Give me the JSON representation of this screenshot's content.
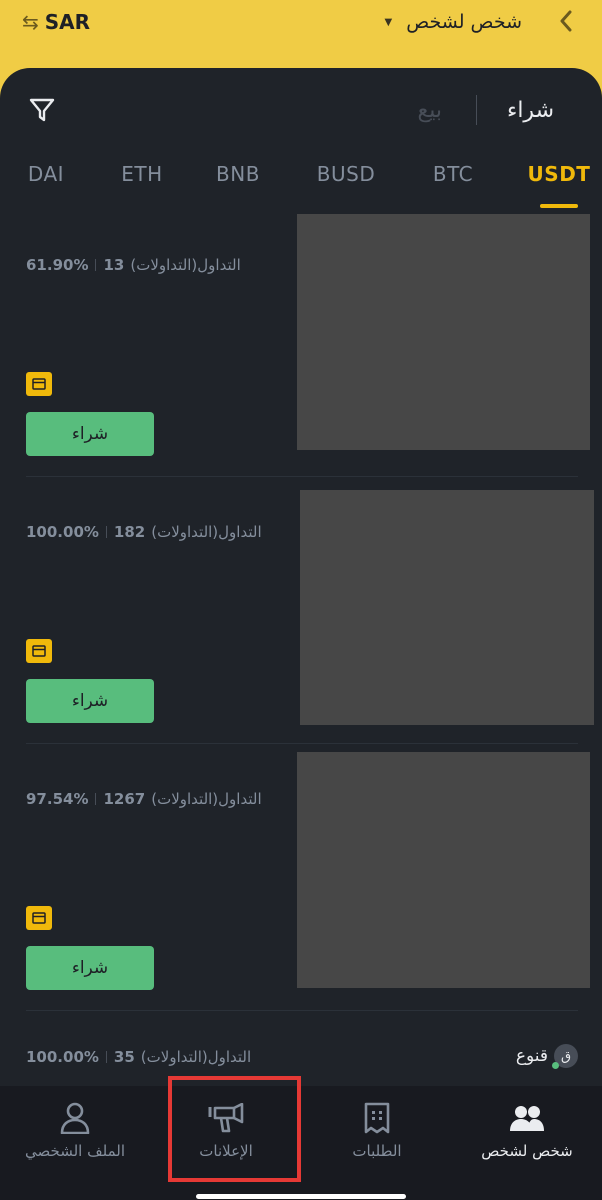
{
  "header": {
    "currency": "SAR",
    "mode": "شخص لشخص"
  },
  "side_tabs": {
    "buy": "شراء",
    "sell": "بيع"
  },
  "asset_tabs": [
    "DAI",
    "ETH",
    "BNB",
    "BUSD",
    "BTC",
    "USDT"
  ],
  "active_asset": "USDT",
  "offers": [
    {
      "completion": "61.90%",
      "count": "13",
      "trades_label": "التداول(التداولات)",
      "button": "شراء"
    },
    {
      "completion": "100.00%",
      "count": "182",
      "trades_label": "التداول(التداولات)",
      "button": "شراء"
    },
    {
      "completion": "97.54%",
      "count": "1267",
      "trades_label": "التداول(التداولات)",
      "button": "شراء"
    },
    {
      "completion": "100.00%",
      "count": "35",
      "trades_label": "التداول(التداولات)",
      "advertiser": "قنوع",
      "avatar_letter": "ق"
    }
  ],
  "bottom_nav": [
    {
      "label": "شخص لشخص",
      "icon": "users-icon",
      "active": true
    },
    {
      "label": "الطلبات",
      "icon": "orders-icon",
      "active": false
    },
    {
      "label": "الإعلانات",
      "icon": "megaphone-icon",
      "active": false
    },
    {
      "label": "الملف الشخصي",
      "icon": "profile-icon",
      "active": false
    }
  ],
  "colors": {
    "brand": "#F0B90B",
    "header_bg": "#F0CC45",
    "panel_bg": "#1F2329",
    "buy_green": "#58BD7D",
    "highlight": "#E53935"
  }
}
